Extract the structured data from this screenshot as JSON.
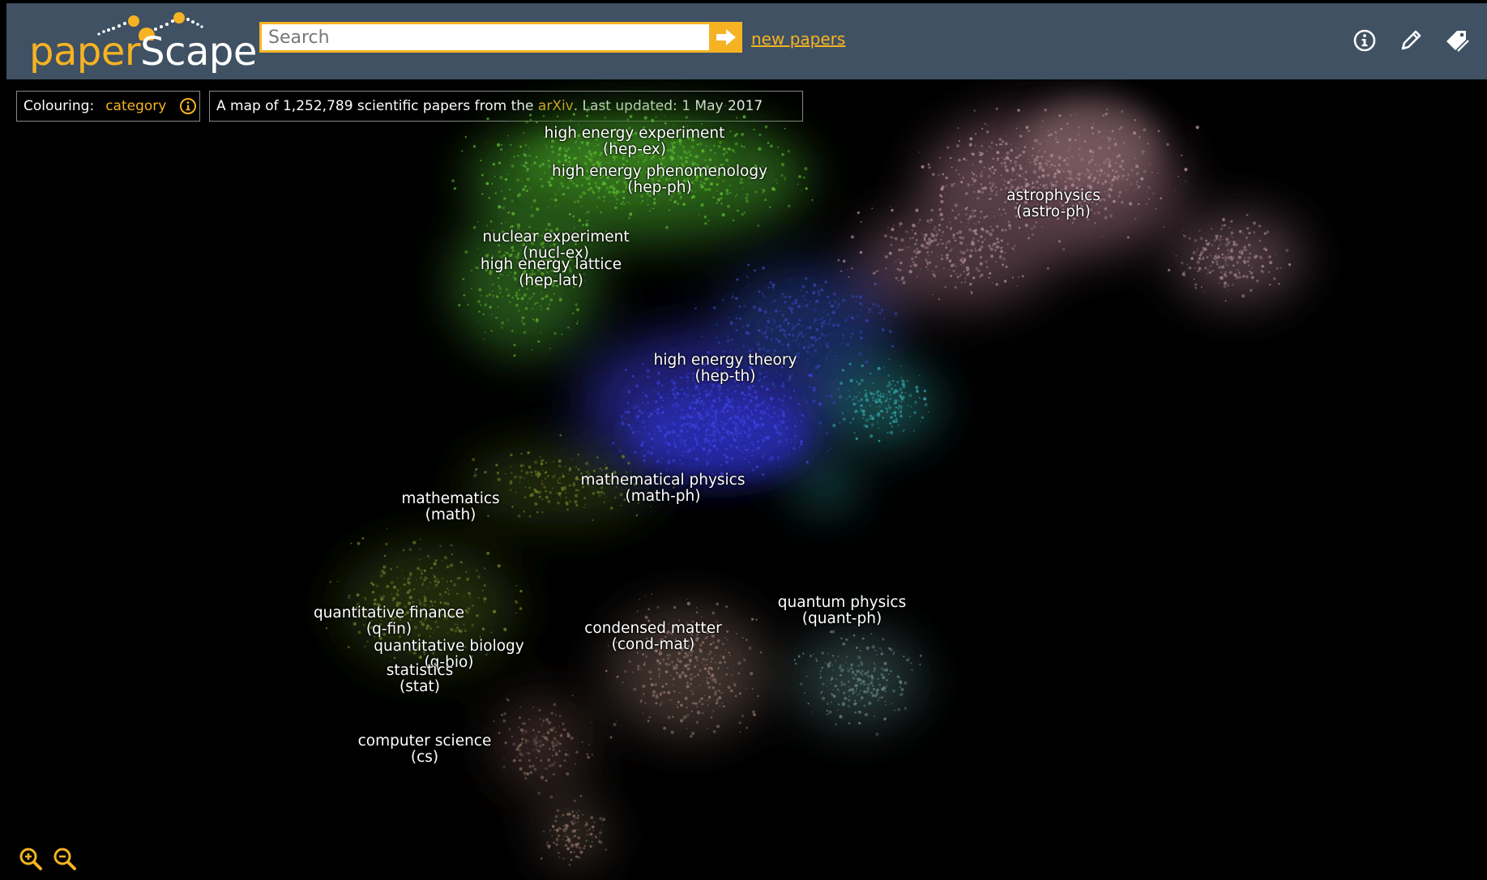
{
  "app": {
    "logo_paper": "paper",
    "logo_scape": "Scape"
  },
  "search": {
    "placeholder": "Search"
  },
  "header": {
    "new_papers_link": "new papers",
    "icons": [
      "info-icon",
      "pencil-icon",
      "tag-icon"
    ]
  },
  "colouring": {
    "label": "Colouring:",
    "value": "category"
  },
  "summary": {
    "prefix": "A map of 1,252,789 scientific papers from the ",
    "source": "arXiv",
    "suffix": ". Last updated: 1 May 2017"
  },
  "colors": {
    "header_bg": "#3f5163",
    "accent": "#f5b323",
    "background": "#000000"
  },
  "categories": [
    {
      "name": "high energy experiment",
      "code": "(hep-ex)"
    },
    {
      "name": "high energy phenomenology",
      "code": "(hep-ph)"
    },
    {
      "name": "nuclear experiment",
      "code": "(nucl-ex)"
    },
    {
      "name": "high energy lattice",
      "code": "(hep-lat)"
    },
    {
      "name": "astrophysics",
      "code": "(astro-ph)"
    },
    {
      "name": "high energy theory",
      "code": "(hep-th)"
    },
    {
      "name": "mathematical physics",
      "code": "(math-ph)"
    },
    {
      "name": "mathematics",
      "code": "(math)"
    },
    {
      "name": "quantum physics",
      "code": "(quant-ph)"
    },
    {
      "name": "quantitative finance",
      "code": "(q-fin)"
    },
    {
      "name": "condensed matter",
      "code": "(cond-mat)"
    },
    {
      "name": "quantitative biology",
      "code": "(q-bio)"
    },
    {
      "name": "statistics",
      "code": "(stat)"
    },
    {
      "name": "computer science",
      "code": "(cs)"
    }
  ],
  "zoom": {
    "in": "zoom-in-icon",
    "out": "zoom-out-icon"
  }
}
